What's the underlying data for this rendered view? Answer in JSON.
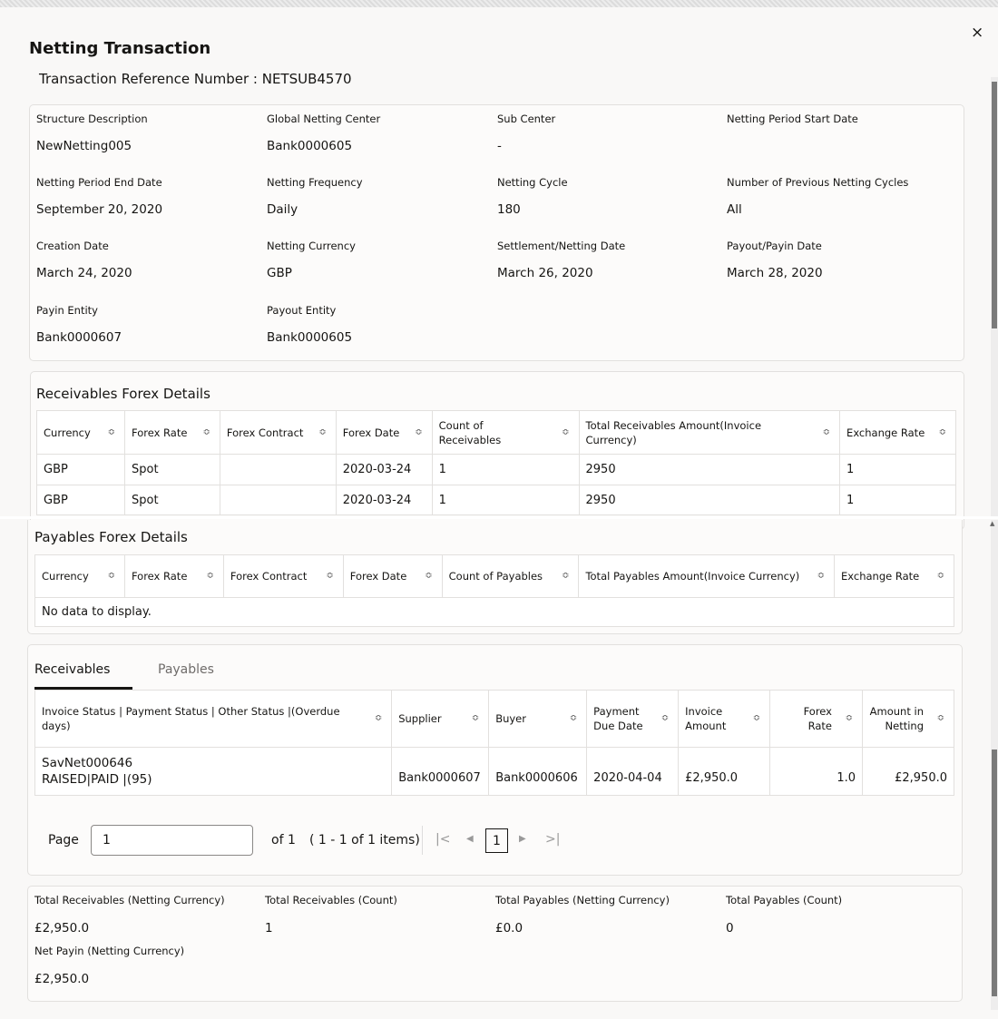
{
  "dialog": {
    "title": "Netting Transaction",
    "reference": "Transaction Reference Number : NETSUB4570",
    "close_icon": "×"
  },
  "details": [
    {
      "label": "Structure Description",
      "value": "NewNetting005"
    },
    {
      "label": "Global Netting Center",
      "value": "Bank0000605"
    },
    {
      "label": "Sub Center",
      "value": "-"
    },
    {
      "label": "Netting Period Start Date",
      "value": ""
    },
    {
      "label": "Netting Period End Date",
      "value": "September 20, 2020"
    },
    {
      "label": "Netting Frequency",
      "value": "Daily"
    },
    {
      "label": "Netting Cycle",
      "value": "180"
    },
    {
      "label": "Number of Previous Netting Cycles",
      "value": "All"
    },
    {
      "label": "Creation Date",
      "value": "March 24, 2020"
    },
    {
      "label": "Netting Currency",
      "value": "GBP"
    },
    {
      "label": "Settlement/Netting Date",
      "value": "March 26, 2020"
    },
    {
      "label": "Payout/Payin Date",
      "value": "March 28, 2020"
    },
    {
      "label": "Payin Entity",
      "value": "Bank0000607"
    },
    {
      "label": "Payout Entity",
      "value": "Bank0000605"
    }
  ],
  "receivables_forex": {
    "title": "Receivables Forex Details",
    "headers": [
      "Currency",
      "Forex Rate",
      "Forex Contract",
      "Forex Date",
      "Count of Receivables",
      "Total Receivables Amount(Invoice Currency)",
      "Exchange Rate"
    ],
    "rows": [
      [
        "GBP",
        "Spot",
        "",
        "2020-03-24",
        "1",
        "2950",
        "1"
      ],
      [
        "GBP",
        "Spot",
        "",
        "2020-03-24",
        "1",
        "2950",
        "1"
      ]
    ]
  },
  "payables_forex": {
    "title": "Payables Forex Details",
    "headers": [
      "Currency",
      "Forex Rate",
      "Forex Contract",
      "Forex Date",
      "Count of Payables",
      "Total Payables Amount(Invoice Currency)",
      "Exchange Rate"
    ],
    "empty": "No data to display."
  },
  "tabs": [
    "Receivables",
    "Payables"
  ],
  "invoices": {
    "headers": [
      "Invoice Status | Payment Status | Other Status |(Overdue days)",
      "Supplier",
      "Buyer",
      "Payment Due Date",
      "Invoice Amount",
      "Forex Rate",
      "Amount in Netting"
    ],
    "rows": [
      {
        "id": "SavNet000646",
        "status": "RAISED|PAID |(95)",
        "supplier": "Bank0000607",
        "buyer": "Bank0000606",
        "due": "2020-04-04",
        "amount": "£2,950.0",
        "rate": "1.0",
        "netting": "£2,950.0"
      }
    ]
  },
  "pagination": {
    "label": "Page",
    "value": "1",
    "of": "of 1",
    "range": "( 1 - 1 of 1 items)",
    "current": "1"
  },
  "totals": [
    {
      "label": "Total Receivables (Netting Currency)",
      "value": "£2,950.0"
    },
    {
      "label": "Total Receivables (Count)",
      "value": "1"
    },
    {
      "label": "Total Payables (Netting Currency)",
      "value": "£0.0"
    },
    {
      "label": "Total Payables (Count)",
      "value": "0"
    },
    {
      "label": "Net Payin (Netting Currency)",
      "value": "£2,950.0"
    }
  ]
}
